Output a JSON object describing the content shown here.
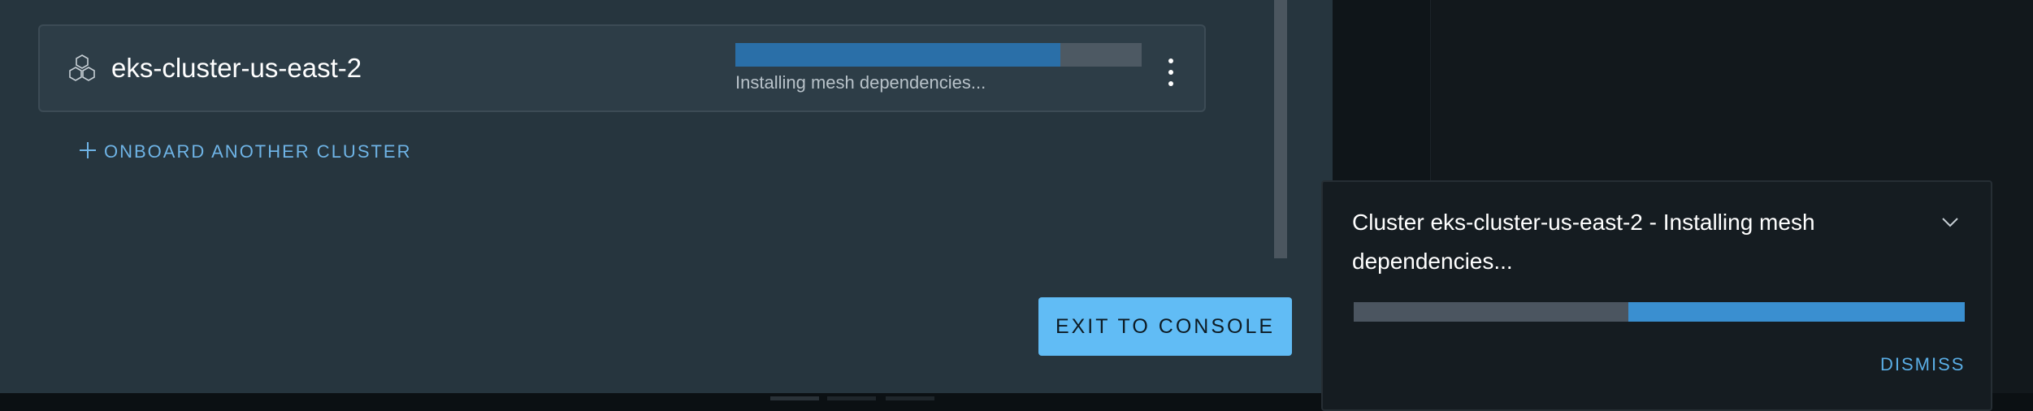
{
  "cluster": {
    "name": "eks-cluster-us-east-2",
    "icon": "hexagon-cluster-icon",
    "progress_fraction": 0.8,
    "status": "Installing mesh dependencies..."
  },
  "actions": {
    "onboard_label": "ONBOARD ANOTHER CLUSTER",
    "exit_label": "EXIT TO CONSOLE"
  },
  "toast": {
    "message": "Cluster eks-cluster-us-east-2 - Installing mesh dependencies...",
    "progress_fraction": 0.55,
    "dismiss_label": "DISMISS"
  },
  "colors": {
    "accent": "#61bcf5",
    "link": "#6fb4e6",
    "progress": "#2a6fa8"
  }
}
